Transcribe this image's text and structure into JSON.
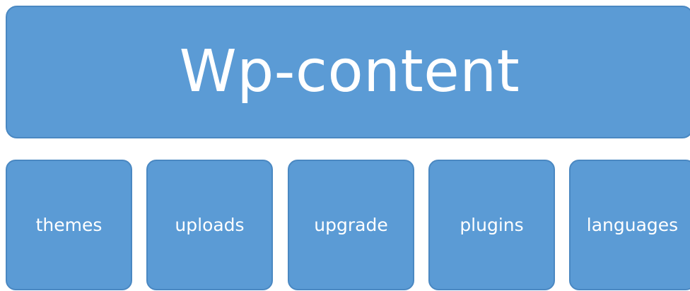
{
  "root": {
    "label": "Wp-content"
  },
  "children": [
    {
      "label": "themes"
    },
    {
      "label": "uploads"
    },
    {
      "label": "upgrade"
    },
    {
      "label": "plugins"
    },
    {
      "label": "languages"
    }
  ],
  "colors": {
    "box_fill": "#5b9bd5",
    "box_border": "#4a88c2",
    "text": "#ffffff",
    "background": "#ffffff"
  }
}
